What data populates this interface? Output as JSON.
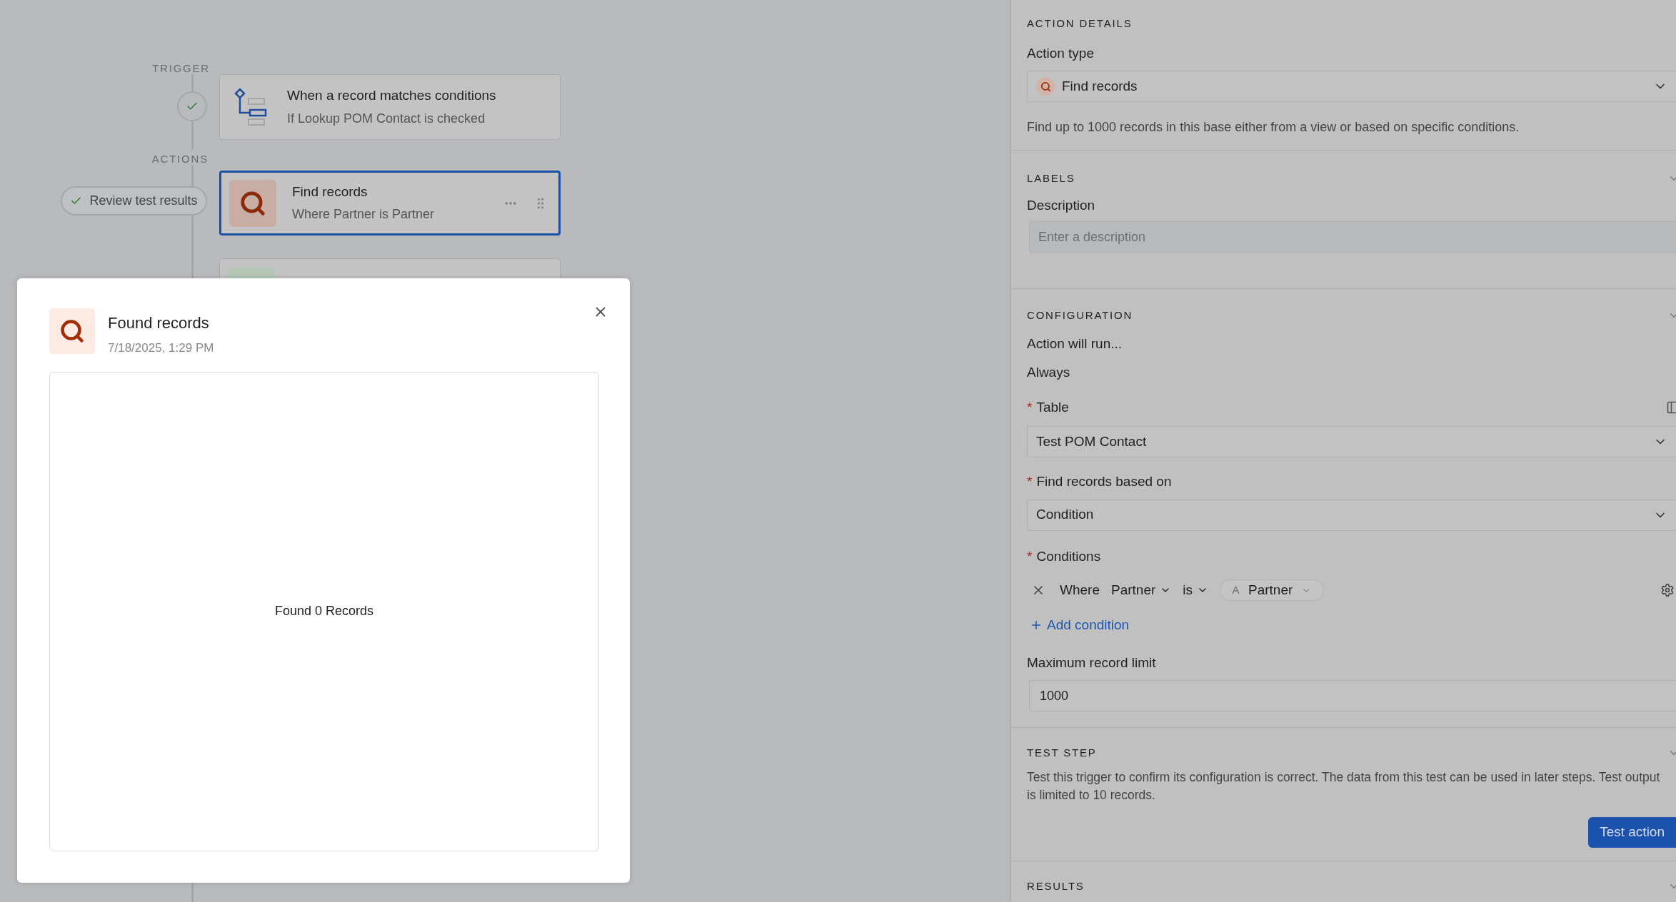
{
  "required_mark": "*",
  "trigger": {
    "section_label": "TRIGGER",
    "completed": true,
    "title": "When a record matches conditions",
    "subtitle": "If Lookup POM Contact is checked"
  },
  "actions": {
    "section_label": "ACTIONS",
    "review_button": {
      "label": "Review test results",
      "completed": true
    },
    "steps": [
      {
        "title": "Find records",
        "subtitle": "Where Partner is Partner",
        "selected": true
      }
    ]
  },
  "modal": {
    "title": "Found records",
    "timestamp": "7/18/2025, 1:29 PM",
    "empty_message": "Found 0 Records"
  },
  "panel": {
    "action_details": {
      "heading": "ACTION DETAILS",
      "action_type_label": "Action type",
      "action_type_value": "Find records",
      "description": "Find up to 1000 records in this base either from a view or based on specific conditions."
    },
    "labels": {
      "heading": "LABELS",
      "description_label": "Description",
      "description_placeholder": "Enter a description"
    },
    "configuration": {
      "heading": "CONFIGURATION",
      "run_label": "Action will run...",
      "run_value": "Always",
      "table": {
        "label": "Table",
        "required": true,
        "value": "Test POM Contact"
      },
      "based_on": {
        "label": "Find records based on",
        "required": true,
        "value": "Condition"
      },
      "conditions": {
        "label": "Conditions",
        "required": true,
        "prefix": "Where",
        "field": "Partner",
        "operator": "is",
        "value": "Partner"
      },
      "add_condition": "Add condition",
      "limit_label": "Maximum record limit",
      "limit_value": "1000"
    },
    "test_step": {
      "heading": "TEST STEP",
      "text": "Test this trigger to confirm its configuration is correct. The data from this test can be used in later steps. Test output is limited to 10 records.",
      "button": "Test action"
    },
    "results": {
      "heading": "RESULTS"
    }
  }
}
